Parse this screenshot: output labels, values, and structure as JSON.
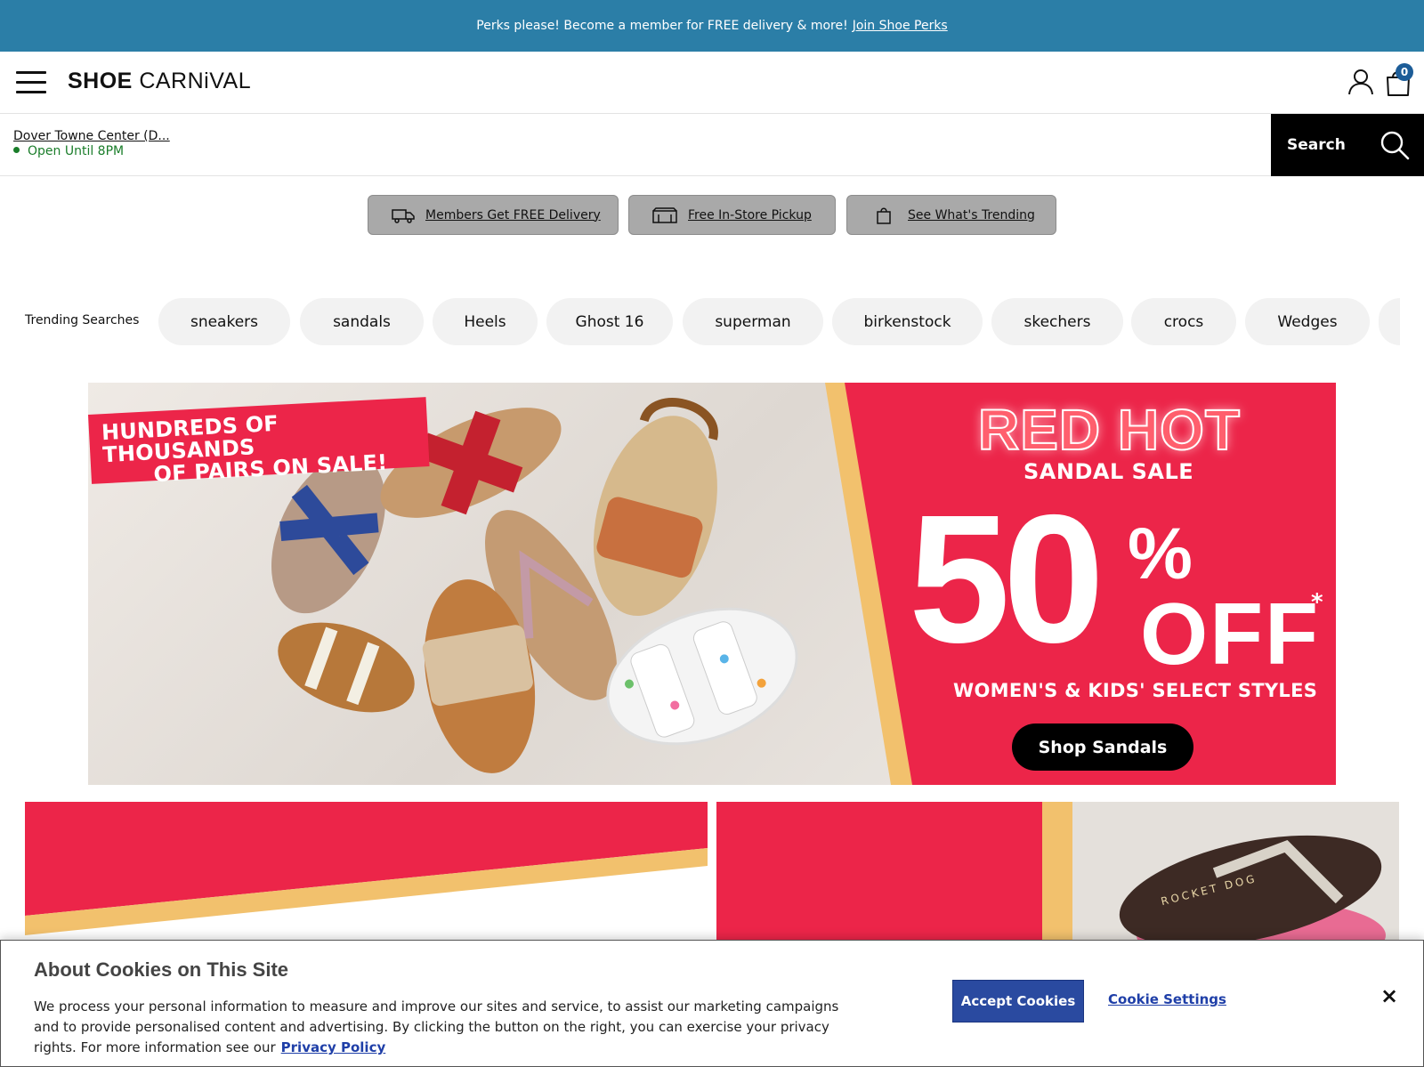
{
  "promo": {
    "text": "Perks please! Become a member for FREE delivery & more!",
    "link": "Join Shoe Perks"
  },
  "header": {
    "logo_bold": "SHOE",
    "logo_light": "CARNiVAL",
    "cart_count": "0"
  },
  "store": {
    "name": "Dover Towne Center (D...",
    "hours": "Open Until 8PM"
  },
  "search": {
    "placeholder": "",
    "button_label": "Search"
  },
  "perks": [
    {
      "label": "Members Get FREE Delivery",
      "icon": "truck-icon"
    },
    {
      "label": "Free In-Store Pickup",
      "icon": "store-icon"
    },
    {
      "label": "See What's Trending",
      "icon": "shopping-bag-icon"
    }
  ],
  "trending": {
    "label": "Trending Searches",
    "chips": [
      "sneakers",
      "sandals",
      "Heels",
      "Ghost 16",
      "superman",
      "birkenstock",
      "skechers",
      "crocs",
      "Wedges"
    ]
  },
  "hero": {
    "tag_line1": "HUNDREDS OF THOUSANDS",
    "tag_line2": "OF PAIRS ON SALE!",
    "title": "RED HOT",
    "subtitle": "SANDAL SALE",
    "big_number": "50",
    "percent": "%",
    "off": "OFF",
    "asterisk": "*",
    "description": "WOMEN'S & KIDS' SELECT STYLES",
    "cta": "Shop Sandals"
  },
  "tiles": {
    "right_brand": "ROCKET DOG"
  },
  "cookie": {
    "title": "About Cookies on This Site",
    "body": "We process your personal information to measure and improve our sites and service, to assist our marketing campaigns and to provide personalised content and advertising. By clicking the button on the right, you can exercise your privacy rights. For more information see our",
    "privacy_link": "Privacy Policy",
    "accept": "Accept Cookies",
    "settings": "Cookie Settings",
    "close": "×"
  },
  "colors": {
    "promo_bg": "#2b7ea7",
    "brand_red": "#ec2549",
    "sand": "#f2c16d",
    "accept_blue": "#2a4aa0"
  }
}
